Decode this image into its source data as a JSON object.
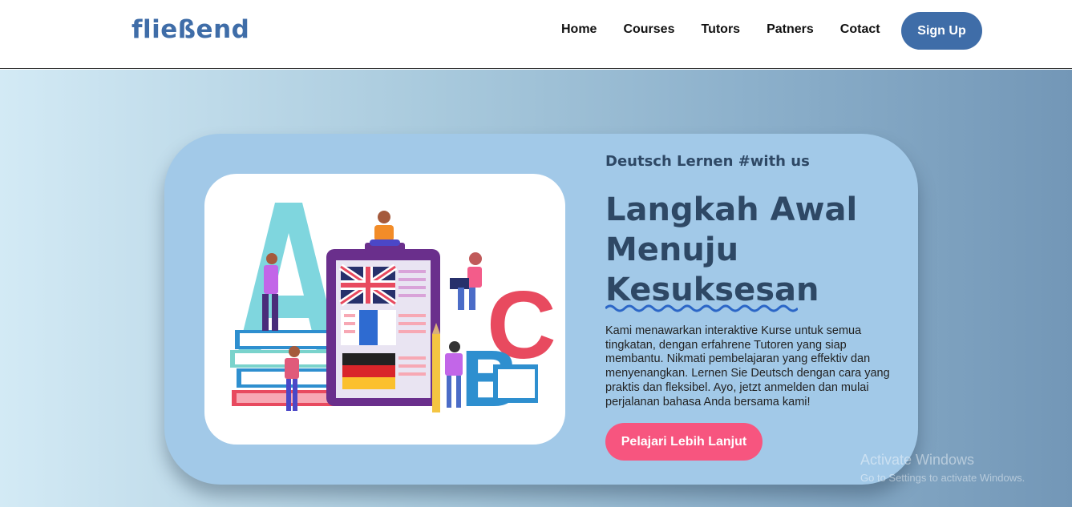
{
  "nav": {
    "brand": "fließend",
    "links": [
      "Home",
      "Courses",
      "Tutors",
      "Patners",
      "Cotact"
    ],
    "signup": "Sign Up"
  },
  "hero": {
    "tagline": "Deutsch Lernen #with us",
    "headline": [
      "Langkah Awal",
      "Menuju",
      "Kesuksesan"
    ],
    "description": "Kami menawarkan interaktive Kurse untuk semua tingkatan, dengan erfahrene Tutoren yang siap membantu. Nikmati pembelajaran yang effektiv dan menyenangkan. Lernen Sie Deutsch dengan cara yang praktis dan fleksibel. Ayo, jetzt anmelden dan mulai perjalanan bahasa Anda bersama kami!",
    "cta": "Pelajari Lebih Lanjut"
  },
  "watermark": {
    "title": "Activate Windows",
    "subtitle": "Go to Settings to activate Windows."
  }
}
